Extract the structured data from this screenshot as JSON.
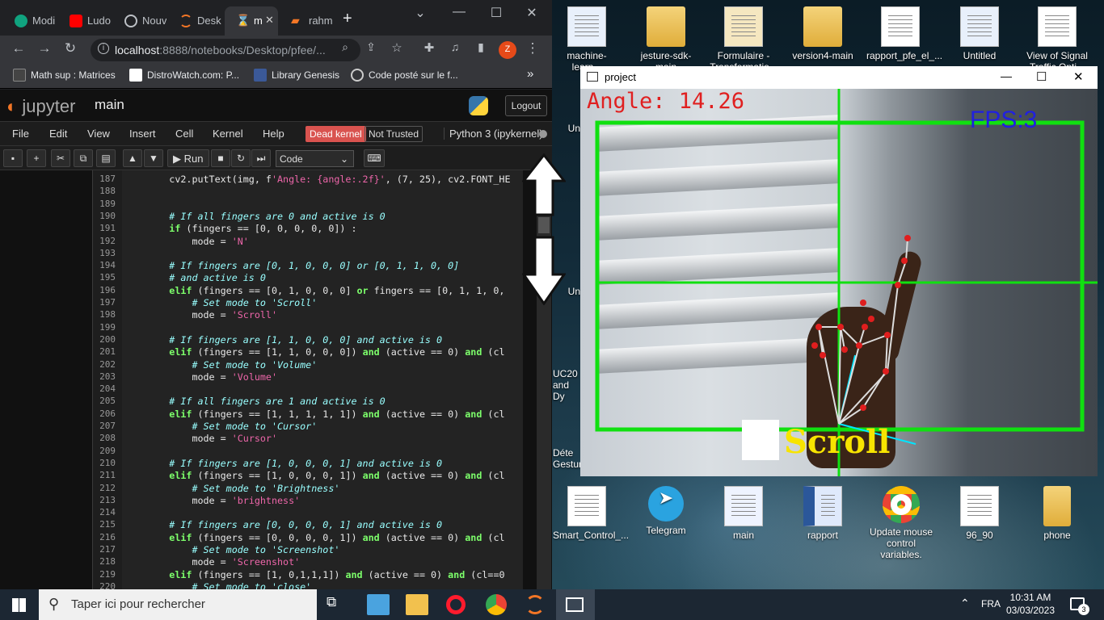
{
  "browser": {
    "tabs": [
      {
        "label": "Modi",
        "color": "#10a37f"
      },
      {
        "label": "Ludo",
        "color": "#ff0000"
      },
      {
        "label": "Nouv",
        "color": "#bdc1c6"
      },
      {
        "label": "Desk",
        "color": "#f37626"
      },
      {
        "label": "m",
        "color": "#f37626"
      },
      {
        "label": "rahm",
        "color": "#f37626"
      }
    ],
    "new_tab": "+",
    "minimize": "⌄",
    "url_host": "localhost",
    "url_path": ":8888/notebooks/Desktop/pfee/...",
    "profile_initial": "Z",
    "bookmarks": [
      "Math sup : Matrices",
      "DistroWatch.com: P...",
      "Library Genesis",
      "Code posté sur le f..."
    ],
    "more_bookmarks": "»"
  },
  "jupyter": {
    "logo": "jupyter",
    "notebook_title": "main",
    "logout": "Logout",
    "menu": [
      "File",
      "Edit",
      "View",
      "Insert",
      "Cell",
      "Kernel",
      "Help"
    ],
    "dead_kernel": "Dead kernel",
    "not_trusted": "Not Trusted",
    "kernel_name": "Python 3 (ipykernel)",
    "run_label": "Run",
    "cell_type": "Code"
  },
  "code": {
    "line_numbers": [
      "187",
      "188",
      "189",
      "190",
      "191",
      "192",
      "193",
      "194",
      "195",
      "196",
      "197",
      "198",
      "199",
      "200",
      "201",
      "202",
      "203",
      "204",
      "205",
      "206",
      "207",
      "208",
      "209",
      "210",
      "211",
      "212",
      "213",
      "214",
      "215",
      "216",
      "217",
      "218",
      "219",
      "220"
    ],
    "lines": [
      "        cv2.putText(img, f'Angle: {angle:.2f}', (7, 25), cv2.FONT_HE",
      "",
      "",
      "        # If all fingers are 0 and active is 0",
      "        if (fingers == [0, 0, 0, 0, 0]) :",
      "            mode = 'N'",
      "",
      "        # If fingers are [0, 1, 0, 0, 0] or [0, 1, 1, 0, 0]",
      "        # and active is 0",
      "        elif (fingers == [0, 1, 0, 0, 0] or fingers == [0, 1, 1, 0,",
      "            # Set mode to 'Scroll'",
      "            mode = 'Scroll'",
      "",
      "        # If fingers are [1, 1, 0, 0, 0] and active is 0",
      "        elif (fingers == [1, 1, 0, 0, 0]) and (active == 0) and (cl",
      "            # Set mode to 'Volume'",
      "            mode = 'Volume'",
      "",
      "        # If all fingers are 1 and active is 0",
      "        elif (fingers == [1, 1, 1, 1, 1]) and (active == 0) and (cl",
      "            # Set mode to 'Cursor'",
      "            mode = 'Cursor'",
      "",
      "        # If fingers are [1, 0, 0, 0, 1] and active is 0",
      "        elif (fingers == [1, 0, 0, 0, 1]) and (active == 0) and (cl",
      "            # Set mode to 'Brightness'",
      "            mode = 'brightness'",
      "",
      "        # If fingers are [0, 0, 0, 0, 1] and active is 0",
      "        elif (fingers == [0, 0, 0, 0, 1]) and (active == 0) and (cl",
      "            # Set mode to 'Screenshot'",
      "            mode = 'Screenshot'",
      "        elif (fingers == [1, 0,1,1,1]) and (active == 0) and (cl==0",
      "            # Set mode to 'close'"
    ]
  },
  "project_window": {
    "title": "project",
    "angle_text": "Angle: 14.26",
    "fps_text": "FPS:3",
    "mode_text": "Scroll"
  },
  "desktop": {
    "icons_top": [
      "machine-learn...",
      "jesture-sdk-main",
      "Formulaire - Transformatio...",
      "version4-main",
      "rapport_pfe_el_...",
      "Untitled",
      "View of Signal Traffic Opti..."
    ],
    "icons_left": [
      "Un",
      "Un",
      "UC20 and Dy",
      "Déte Gestur"
    ],
    "icons_bottom": [
      "Smart_Control_...",
      "Telegram",
      "main",
      "rapport",
      "Update mouse control variables.",
      "96_90",
      "phone"
    ]
  },
  "taskbar": {
    "search_placeholder": "Taper ici pour rechercher",
    "language": "FRA",
    "time": "10:31 AM",
    "date": "03/03/2023",
    "notifications": "3"
  },
  "colors": {
    "jupyter_orange": "#f37626",
    "dead_kernel_red": "#d9534f",
    "overlay_green": "#10e010",
    "scroll_yellow": "#f7e400"
  }
}
